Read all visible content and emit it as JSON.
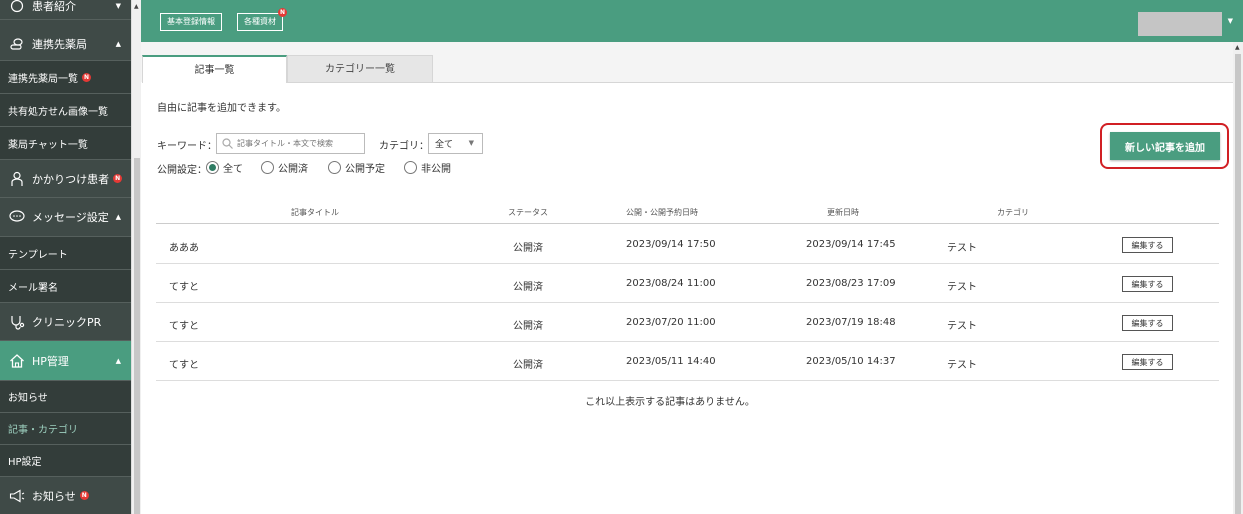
{
  "sidebar": {
    "top_item": "患者紹介",
    "pharmacy_section": "連携先薬局",
    "pharmacy_list": "連携先薬局一覧",
    "shared_rx": "共有処方せん画像一覧",
    "pharmacy_chat": "薬局チャット一覧",
    "patients": "かかりつけ患者",
    "message_settings": "メッセージ設定",
    "template": "テンプレート",
    "mail_signature": "メール署名",
    "clinic_pr": "クリニックPR",
    "hp_admin": "HP管理",
    "news": "お知らせ",
    "articles_categories": "記事・カテゴリ",
    "hp_settings": "HP設定",
    "announcements": "お知らせ",
    "badge": "N"
  },
  "header": {
    "basic_info": "基本登録情報",
    "materials": "各種資材",
    "badge": "N"
  },
  "tabs": {
    "articles": "記事一覧",
    "categories": "カテゴリー一覧"
  },
  "main": {
    "description": "自由に記事を追加できます。",
    "keyword_label": "キーワード：",
    "search_placeholder": "記事タイトル・本文で検索",
    "category_label": "カテゴリ：",
    "category_value": "全て",
    "publish_label": "公開設定：",
    "radios": [
      "全て",
      "公開済",
      "公開予定",
      "非公開"
    ],
    "add_button": "新しい記事を追加",
    "no_more": "これ以上表示する記事はありません。"
  },
  "table": {
    "headers": [
      "記事タイトル",
      "ステータス",
      "公開・公開予約日時",
      "更新日時",
      "カテゴリ"
    ],
    "edit_label": "編集する",
    "rows": [
      {
        "title": "あああ",
        "status": "公開済",
        "published": "2023/09/14 17:50",
        "updated": "2023/09/14 17:45",
        "category": "テスト"
      },
      {
        "title": "てすと",
        "status": "公開済",
        "published": "2023/08/24 11:00",
        "updated": "2023/08/23 17:09",
        "category": "テスト"
      },
      {
        "title": "てすと",
        "status": "公開済",
        "published": "2023/07/20 11:00",
        "updated": "2023/07/19 18:48",
        "category": "テスト"
      },
      {
        "title": "てすと",
        "status": "公開済",
        "published": "2023/05/11 14:40",
        "updated": "2023/05/10 14:37",
        "category": "テスト"
      }
    ]
  },
  "colors": {
    "brand_green": "#4a9d80",
    "sidebar_bg": "#3f4a47",
    "badge_red": "#e53935",
    "highlight_red": "#d11f24"
  }
}
